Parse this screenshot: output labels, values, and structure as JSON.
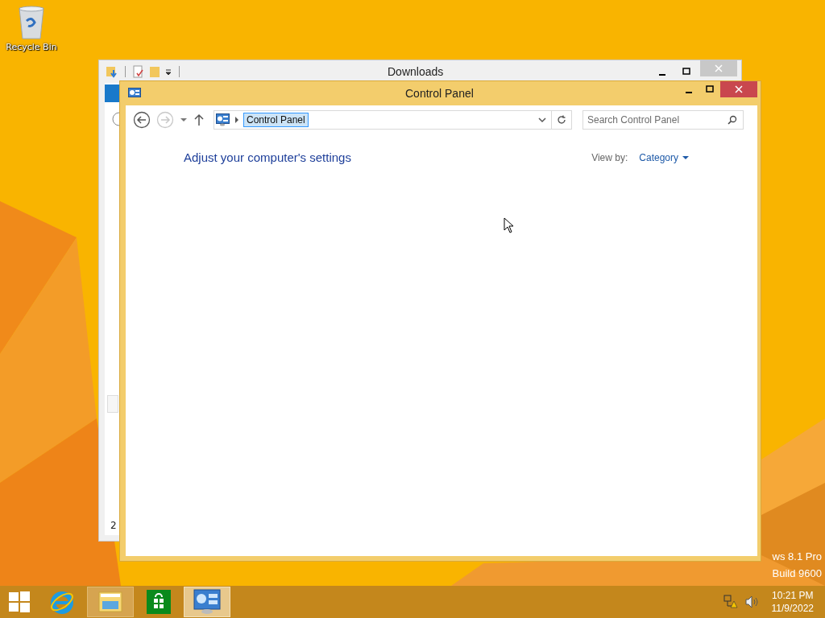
{
  "desktop": {
    "icons": [
      {
        "label": "Recycle Bin"
      }
    ],
    "watermark": [
      "ws 8.1 Pro",
      "Build 9600"
    ]
  },
  "back_window": {
    "title": "Downloads",
    "status_text": "2"
  },
  "window": {
    "title": "Control Panel",
    "address": {
      "crumb": "Control Panel",
      "selected": true
    },
    "search": {
      "placeholder": "Search Control Panel"
    },
    "heading": "Adjust your computer's settings",
    "view_by": {
      "label": "View by:",
      "value": "Category"
    }
  },
  "taskbar": {
    "apps": [
      {
        "kind": "ie",
        "running": false,
        "selected": false
      },
      {
        "kind": "explorer",
        "running": true,
        "selected": false
      },
      {
        "kind": "store",
        "running": false,
        "selected": false
      },
      {
        "kind": "control",
        "running": true,
        "selected": true
      }
    ],
    "clock": {
      "time": "10:21 PM",
      "date": "11/9/2022"
    }
  }
}
